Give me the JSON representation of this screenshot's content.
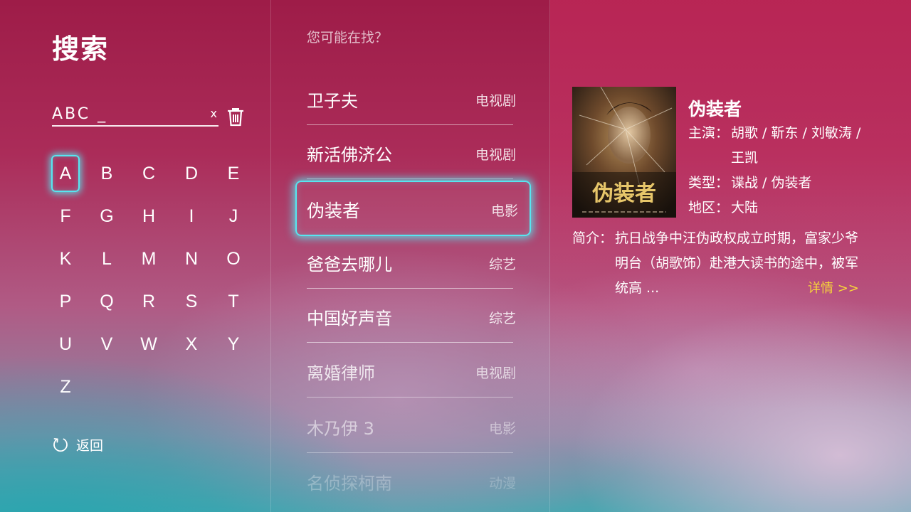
{
  "left": {
    "title": "搜索",
    "search": {
      "value": "ABC _",
      "clear_label": "x"
    },
    "keys": [
      "A",
      "B",
      "C",
      "D",
      "E",
      "F",
      "G",
      "H",
      "I",
      "J",
      "K",
      "L",
      "M",
      "N",
      "O",
      "P",
      "Q",
      "R",
      "S",
      "T",
      "U",
      "V",
      "W",
      "X",
      "Y",
      "Z"
    ],
    "focused_key": "A",
    "back_label": "返回"
  },
  "middle": {
    "hint": "您可能在找？",
    "items": [
      {
        "name": "卫子夫",
        "category": "电视剧",
        "opacity": 1
      },
      {
        "name": "新活佛济公",
        "category": "电视剧",
        "opacity": 1
      },
      {
        "name": "伪装者",
        "category": "电影",
        "opacity": 1,
        "selected": true
      },
      {
        "name": "爸爸去哪儿",
        "category": "综艺",
        "opacity": 1
      },
      {
        "name": "中国好声音",
        "category": "综艺",
        "opacity": 1
      },
      {
        "name": "离婚律师",
        "category": "电视剧",
        "opacity": 0.8
      },
      {
        "name": "木乃伊 3",
        "category": "电影",
        "opacity": 0.55
      },
      {
        "name": "名侦探柯南",
        "category": "动漫",
        "opacity": 0.28
      }
    ]
  },
  "detail": {
    "poster_title": "伪装者",
    "title": "伪装者",
    "cast_label": "主演：",
    "cast": "胡歌 / 靳东 / 刘敏涛 / 王凯",
    "genre_label": "类型：",
    "genre": "谍战 / 伪装者",
    "region_label": "地区：",
    "region": "大陆",
    "synopsis_label": "简介：",
    "synopsis": "抗日战争中汪伪政权成立时期，富家少爷明台（胡歌饰）赴港大读书的途中，被军统高 ...",
    "more_label": "详情 >>",
    "more_color": "#f7d53a"
  },
  "colors": {
    "focus": "#57e6f0"
  }
}
